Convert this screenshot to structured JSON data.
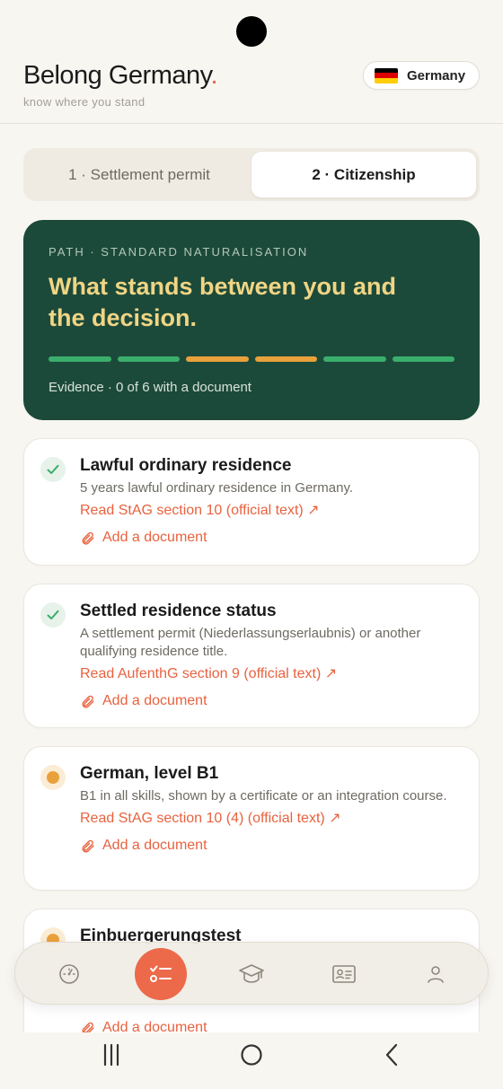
{
  "header": {
    "brand_name": "Belong Germany",
    "brand_dot": ".",
    "tagline": "know where you stand",
    "country": "Germany",
    "flag_icon": "germany-flag-icon"
  },
  "tabs": [
    {
      "label": "1 · Settlement permit",
      "active": false
    },
    {
      "label": "2 · Citizenship",
      "active": true
    }
  ],
  "hero": {
    "eyebrow": "PATH · STANDARD NATURALISATION",
    "headline_line1": "What stands between you and",
    "headline_line2": "the decision.",
    "progress_segments": [
      "done",
      "done",
      "pending",
      "pending",
      "done",
      "done"
    ],
    "evidence": "Evidence · 0 of 6 with a document"
  },
  "requirements": [
    {
      "status": "done",
      "title": "Lawful ordinary residence",
      "description": "5 years lawful ordinary residence in Germany.",
      "link": "Read StAG section 10 (official text) ↗",
      "add_label": "Add a document"
    },
    {
      "status": "done",
      "title": "Settled residence status",
      "description": "A settlement permit (Niederlassungserlaubnis) or another qualifying residence title.",
      "link": "Read AufenthG section 9 (official text) ↗",
      "add_label": "Add a document"
    },
    {
      "status": "pending",
      "title": "German, level B1",
      "description": "B1 in all skills, shown by a certificate or an integration course.",
      "link": "Read StAG section 10 (4) (official text) ↗",
      "add_label": "Add a document"
    },
    {
      "status": "pending",
      "title": "Einbuergerungstest",
      "description": "",
      "link": "",
      "add_label": "Add a document"
    }
  ],
  "nav": [
    {
      "icon": "dashboard-gauge-icon",
      "active": false
    },
    {
      "icon": "checklist-icon",
      "active": true
    },
    {
      "icon": "graduation-cap-icon",
      "active": false
    },
    {
      "icon": "id-card-icon",
      "active": false
    },
    {
      "icon": "profile-icon",
      "active": false
    }
  ],
  "colors": {
    "accent": "#e8623f",
    "hero_bg": "#1c4a3a",
    "hero_headline": "#f0d584",
    "done": "#3aae6c",
    "pending": "#e9a13b"
  }
}
